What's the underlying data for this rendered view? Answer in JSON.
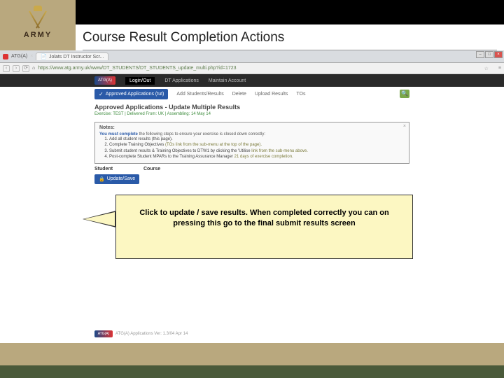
{
  "brand": {
    "name": "ARMY"
  },
  "slide": {
    "title": "Course Result Completion Actions"
  },
  "browser": {
    "tab_label": "Jolats DT Instructor Scr...",
    "url": "https://www.atg.army.uk/www/DT_STUDENTS/DT_STUDENTS_update_multi.php?id=1723"
  },
  "app_header": {
    "logo_text": "ATG(A)",
    "items": [
      "Login/Out",
      "DT Applications",
      "Maintain Account"
    ]
  },
  "action_bar": {
    "approved_label": "Approved Applications (tut)",
    "links": [
      "Add Students/Results",
      "Delete",
      "Upload Results",
      "TOs"
    ]
  },
  "page": {
    "heading": "Approved Applications - Update Multiple Results",
    "meta": "Exercise: TEST | Delivered From: UK | Assembling: 14 May 14"
  },
  "notes": {
    "title": "Notes:",
    "lead": "You must complete",
    "lead_rest": " the following steps to ensure your exercise is closed down correctly:",
    "items": [
      {
        "a": "Add all student results (this page).",
        "b": ""
      },
      {
        "a": "Complete Training Objectives ",
        "b": "(TOs link from the sub-menu at the top of the page)."
      },
      {
        "a": "Submit student results & Training Objectives to DTW1 by clicking the 'Utilise",
        "b": " link from the sub-menu above."
      },
      {
        "a": "Post-complete Student MPARs to the Training Assurance Manager ",
        "b": "21 days of exercise completion."
      }
    ]
  },
  "table": {
    "cols": [
      "Student",
      "Course"
    ]
  },
  "buttons": {
    "update": "Update/Save"
  },
  "callout": {
    "text": "Click to update / save results. When completed correctly you can on pressing this go to the final submit results screen"
  },
  "footer": {
    "text": "ATG(A) Applications   Ver: 1.3/04 Apr 14"
  }
}
